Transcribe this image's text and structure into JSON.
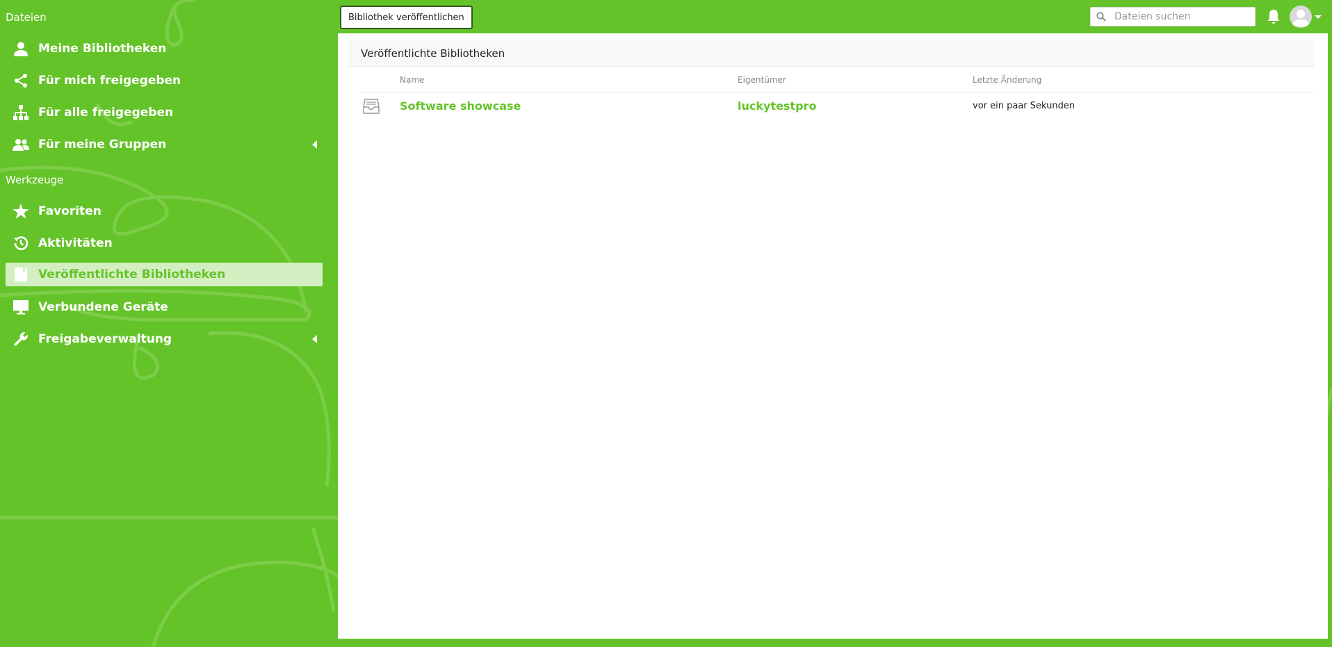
{
  "colors": {
    "brand_green": "#65c32a",
    "active_bg": "#d3efc1",
    "panel_bg": "#ffffff",
    "header_bg": "#f8f8f8"
  },
  "sidebar": {
    "files_heading": "Dateien",
    "tools_heading": "Werkzeuge",
    "files_items": [
      {
        "label": "Meine Bibliotheken",
        "icon": "user-icon"
      },
      {
        "label": "Für mich freigegeben",
        "icon": "share-icon"
      },
      {
        "label": "Für alle freigegeben",
        "icon": "org-chart-icon"
      },
      {
        "label": "Für meine Gruppen",
        "icon": "group-icon",
        "expandable": true
      }
    ],
    "tools_items": [
      {
        "label": "Favoriten",
        "icon": "star-icon"
      },
      {
        "label": "Aktivitäten",
        "icon": "history-icon"
      },
      {
        "label": "Veröffentlichte Bibliotheken",
        "icon": "book-icon",
        "active": true
      },
      {
        "label": "Verbundene Geräte",
        "icon": "monitor-icon"
      },
      {
        "label": "Freigabeverwaltung",
        "icon": "wrench-icon",
        "expandable": true
      }
    ]
  },
  "topbar": {
    "publish_button": "Bibliothek veröffentlichen",
    "search_placeholder": "Dateien suchen"
  },
  "main": {
    "title": "Veröffentlichte Bibliotheken",
    "columns": [
      "Name",
      "Eigentümer",
      "Letzte Änderung"
    ],
    "rows": [
      {
        "name": "Software showcase",
        "owner": "luckytestpro",
        "modified": "vor ein paar Sekunden"
      }
    ]
  }
}
